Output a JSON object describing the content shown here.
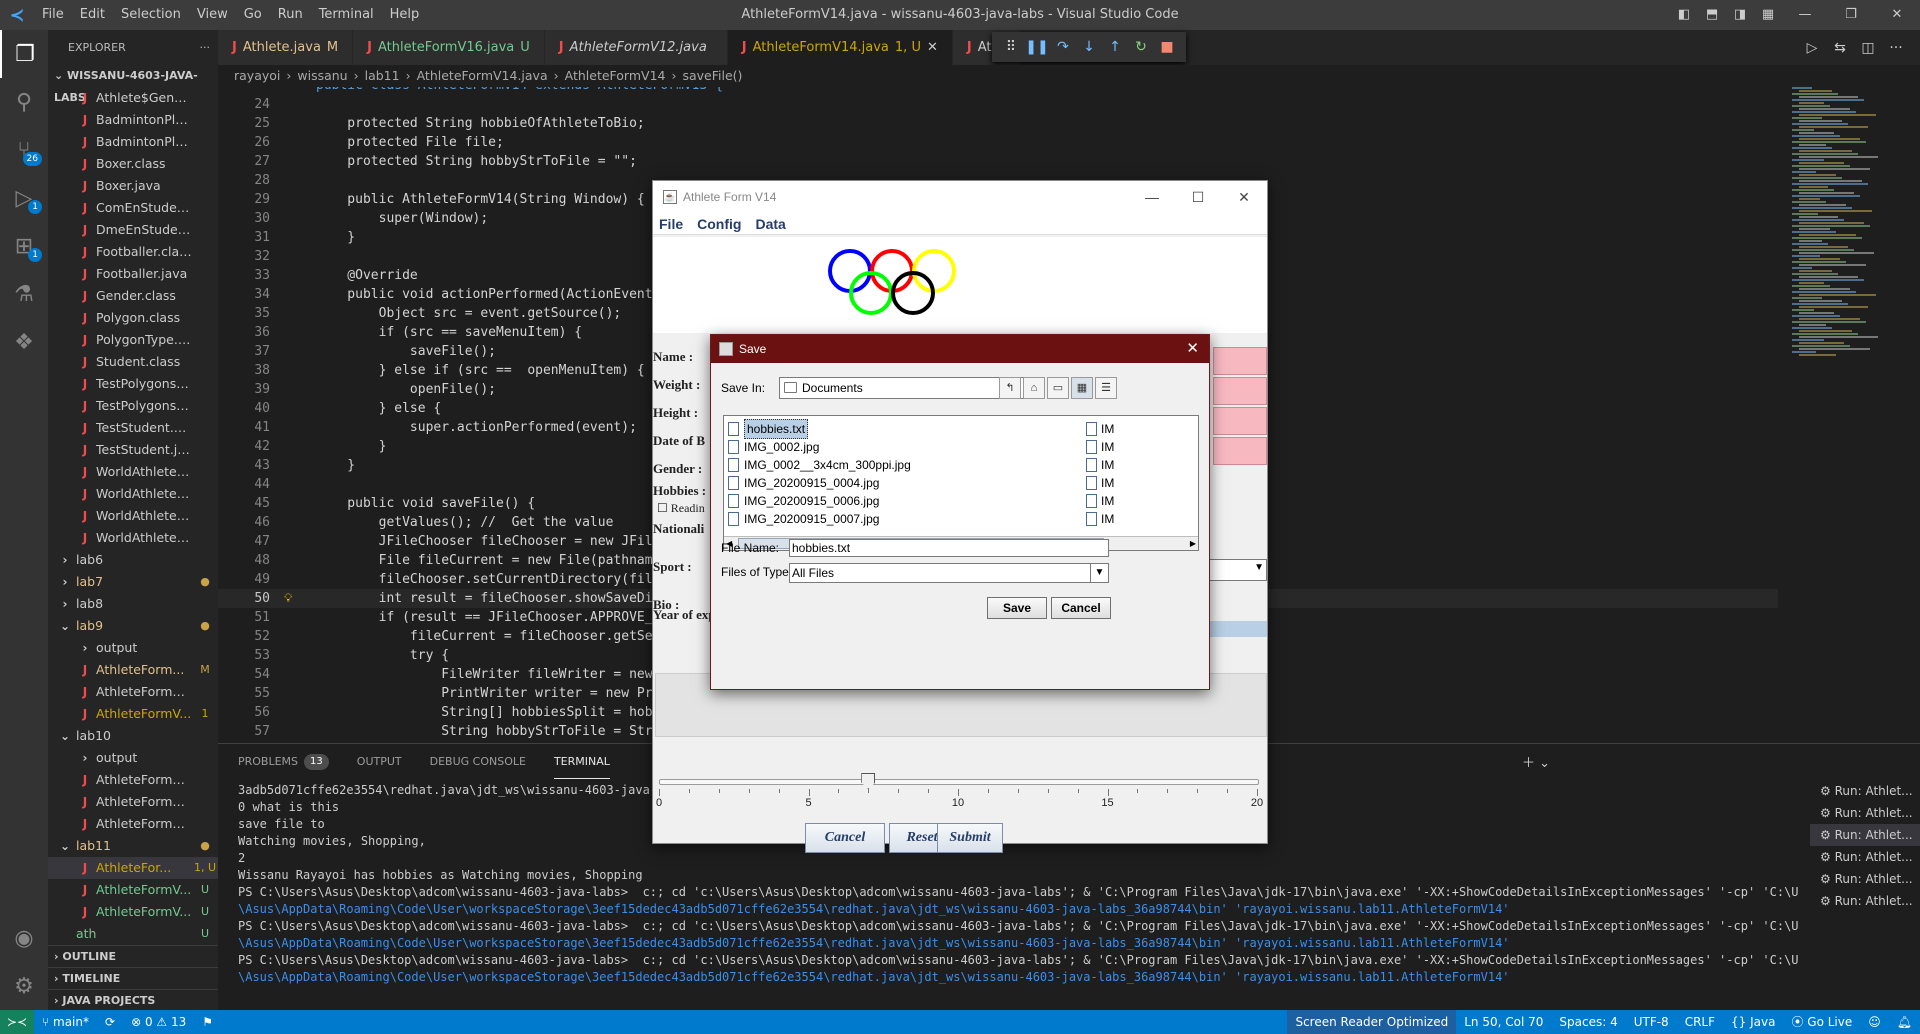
{
  "titlebar": {
    "menu": [
      "File",
      "Edit",
      "Selection",
      "View",
      "Go",
      "Run",
      "Terminal",
      "Help"
    ],
    "title": "AthleteFormV14.java - wissanu-4603-java-labs - Visual Studio Code"
  },
  "activity": {
    "scm_badge": "26",
    "debug_badge": "1",
    "ext_badge": "1"
  },
  "explorer": {
    "header": "EXPLORER",
    "project": "WISSANU-4603-JAVA-LABS",
    "items": [
      {
        "label": "Athlete$Gender.class",
        "status": "",
        "kind": "file"
      },
      {
        "label": "BadmintonPlayer.cl...",
        "status": "",
        "kind": "file"
      },
      {
        "label": "BadmintonPlayer.ja...",
        "status": "",
        "kind": "file"
      },
      {
        "label": "Boxer.class",
        "status": "",
        "kind": "file"
      },
      {
        "label": "Boxer.java",
        "status": "",
        "kind": "file"
      },
      {
        "label": "ComEnStudent.class",
        "status": "",
        "kind": "file"
      },
      {
        "label": "DmeEnStudent.class",
        "status": "",
        "kind": "file"
      },
      {
        "label": "Footballer.class",
        "status": "",
        "kind": "file"
      },
      {
        "label": "Footballer.java",
        "status": "",
        "kind": "file"
      },
      {
        "label": "Gender.class",
        "status": "",
        "kind": "file"
      },
      {
        "label": "Polygon.class",
        "status": "",
        "kind": "file"
      },
      {
        "label": "PolygonType.class",
        "status": "",
        "kind": "file"
      },
      {
        "label": "Student.class",
        "status": "",
        "kind": "file"
      },
      {
        "label": "TestPolygons.class",
        "status": "",
        "kind": "file"
      },
      {
        "label": "TestPolygons.java",
        "status": "",
        "kind": "file"
      },
      {
        "label": "TestStudent.class",
        "status": "",
        "kind": "file"
      },
      {
        "label": "TestStudent.java",
        "status": "",
        "kind": "file"
      },
      {
        "label": "WorldAthlete.class",
        "status": "",
        "kind": "file"
      },
      {
        "label": "WorldAthlete.java",
        "status": "",
        "kind": "file"
      },
      {
        "label": "WorldAthleteV2.cla...",
        "status": "",
        "kind": "file"
      },
      {
        "label": "WorldAthleteV2.java",
        "status": "",
        "kind": "file"
      },
      {
        "label": "lab6",
        "status": "",
        "kind": "folder"
      },
      {
        "label": "lab7",
        "status": "●",
        "kind": "folder-mod"
      },
      {
        "label": "lab8",
        "status": "",
        "kind": "folder"
      },
      {
        "label": "lab9",
        "status": "●",
        "kind": "folder-open-mod"
      },
      {
        "label": "output",
        "status": "",
        "kind": "subfolder"
      },
      {
        "label": "AthleteForm...",
        "status": "M",
        "kind": "subfile-mod"
      },
      {
        "label": "AthleteFormV9.java",
        "status": "",
        "kind": "subfile"
      },
      {
        "label": "AthleteFormV...",
        "status": "1",
        "kind": "subfile-warn"
      },
      {
        "label": "lab10",
        "status": "",
        "kind": "folder-open"
      },
      {
        "label": "output",
        "status": "",
        "kind": "subfolder"
      },
      {
        "label": "AthleteFormV11.java",
        "status": "",
        "kind": "subfile"
      },
      {
        "label": "AthleteFormV12.java",
        "status": "",
        "kind": "subfile"
      },
      {
        "label": "AthleteFormV13.java",
        "status": "",
        "kind": "subfile"
      },
      {
        "label": "lab11",
        "status": "●",
        "kind": "folder-open-mod"
      },
      {
        "label": "AthleteFor...",
        "status": "1, U",
        "kind": "subfile-sel"
      },
      {
        "label": "AthleteFormV...",
        "status": "U",
        "kind": "subfile-new"
      },
      {
        "label": "AthleteFormV...",
        "status": "U",
        "kind": "subfile-new"
      },
      {
        "label": "ath",
        "status": "U",
        "kind": "root-new"
      }
    ],
    "sections": [
      "OUTLINE",
      "TIMELINE",
      "JAVA PROJECTS"
    ]
  },
  "tabs": [
    {
      "label": "Athlete.java",
      "status": "M",
      "italic": false,
      "active": false
    },
    {
      "label": "AthleteFormV16.java",
      "status": "U",
      "italic": false,
      "active": false
    },
    {
      "label": "AthleteFormV12.java",
      "status": "",
      "italic": true,
      "active": false
    },
    {
      "label": "AthleteFormV14.java",
      "status": "1, U",
      "italic": false,
      "active": true
    },
    {
      "label": "Ath",
      "status": "",
      "italic": false,
      "active": false
    }
  ],
  "breadcrumb": [
    "rayayoi",
    "wissanu",
    "lab11",
    "AthleteFormV14.java",
    "AthleteFormV14",
    "saveFile()"
  ],
  "code": {
    "first_line_partial": "public class AthleteFormV14 extends AthleteFormV13 {",
    "lines": [
      {
        "n": "24",
        "t": ""
      },
      {
        "n": "25",
        "t": "    protected String hobbieOfAthleteToBio;"
      },
      {
        "n": "26",
        "t": "    protected File file;"
      },
      {
        "n": "27",
        "t": "    protected String hobbyStrToFile = \"\";"
      },
      {
        "n": "28",
        "t": ""
      },
      {
        "n": "29",
        "t": "    public AthleteFormV14(String Window) {"
      },
      {
        "n": "30",
        "t": "        super(Window);"
      },
      {
        "n": "31",
        "t": "    }"
      },
      {
        "n": "32",
        "t": ""
      },
      {
        "n": "33",
        "t": "    @Override"
      },
      {
        "n": "34",
        "t": "    public void actionPerformed(ActionEvent event) {"
      },
      {
        "n": "35",
        "t": "        Object src = event.getSource();"
      },
      {
        "n": "36",
        "t": "        if (src == saveMenuItem) {"
      },
      {
        "n": "37",
        "t": "            saveFile();"
      },
      {
        "n": "38",
        "t": "        } else if (src ==  openMenuItem) {"
      },
      {
        "n": "39",
        "t": "            openFile();"
      },
      {
        "n": "40",
        "t": "        } else {"
      },
      {
        "n": "41",
        "t": "            super.actionPerformed(event);"
      },
      {
        "n": "42",
        "t": "        }"
      },
      {
        "n": "43",
        "t": "    }"
      },
      {
        "n": "44",
        "t": ""
      },
      {
        "n": "45",
        "t": "    public void saveFile() {"
      },
      {
        "n": "46",
        "t": "        getValues(); //  Get the value"
      },
      {
        "n": "47",
        "t": "        JFileChooser fileChooser = new JFileChooser();"
      },
      {
        "n": "48",
        "t": "        File fileCurrent = new File(pathname:\"\");"
      },
      {
        "n": "49",
        "t": "        fileChooser.setCurrentDirectory(fileCurrent);"
      },
      {
        "n": "50",
        "t": "        int result = fileChooser.showSaveDialog(this);"
      },
      {
        "n": "51",
        "t": "        if (result == JFileChooser.APPROVE_OPTION) {"
      },
      {
        "n": "52",
        "t": "            fileCurrent = fileChooser.getSelectedFile();"
      },
      {
        "n": "53",
        "t": "            try {"
      },
      {
        "n": "54",
        "t": "                FileWriter fileWriter = new FileWriter(fileCurrent);"
      },
      {
        "n": "55",
        "t": "                PrintWriter writer = new PrintWriter(fileWriter);"
      },
      {
        "n": "56",
        "t": "                String[] hobbiesSplit = hobbiesStr.split(\", \");"
      },
      {
        "n": "57",
        "t": "                String hobbyStrToFile = String.join(\"\\n\", hobbiesSplit);"
      }
    ]
  },
  "panel": {
    "tabs": [
      "PROBLEMS",
      "OUTPUT",
      "DEBUG CONSOLE",
      "TERMINAL"
    ],
    "problems_count": "13",
    "terminal_lines": [
      "3adb5d071cffe62e3554\\redhat.java\\jdt_ws\\wissanu-4603-java-l",
      "0 what is this",
      "save file to",
      "Watching movies, Shopping,",
      "2",
      "Wissanu Rayayoi has hobbies as Watching movies, Shopping",
      "PS C:\\Users\\Asus\\Desktop\\adcom\\wissanu-4603-java-labs>  c:; cd 'c:\\Users\\Asus\\Desktop\\adcom\\wissanu-4603-java-labs'; & 'C:\\Program Files\\Java\\jdk-17\\bin\\java.exe' '-XX:+ShowCodeDetailsInExceptionMessages' '-cp' 'C:\\Users",
      "\\Asus\\AppData\\Roaming\\Code\\User\\workspaceStorage\\3eef15dedec43adb5d071cffe62e3554\\redhat.java\\jdt_ws\\wissanu-4603-java-labs_36a98744\\bin' 'rayayoi.wissanu.lab11.AthleteFormV14'",
      "PS C:\\Users\\Asus\\Desktop\\adcom\\wissanu-4603-java-labs>  c:; cd 'c:\\Users\\Asus\\Desktop\\adcom\\wissanu-4603-java-labs'; & 'C:\\Program Files\\Java\\jdk-17\\bin\\java.exe' '-XX:+ShowCodeDetailsInExceptionMessages' '-cp' 'C:\\Users",
      "\\Asus\\AppData\\Roaming\\Code\\User\\workspaceStorage\\3eef15dedec43adb5d071cffe62e3554\\redhat.java\\jdt_ws\\wissanu-4603-java-labs_36a98744\\bin' 'rayayoi.wissanu.lab11.AthleteFormV14'",
      "PS C:\\Users\\Asus\\Desktop\\adcom\\wissanu-4603-java-labs>  c:; cd 'c:\\Users\\Asus\\Desktop\\adcom\\wissanu-4603-java-labs'; & 'C:\\Program Files\\Java\\jdk-17\\bin\\java.exe' '-XX:+ShowCodeDetailsInExceptionMessages' '-cp' 'C:\\Users",
      "\\Asus\\AppData\\Roaming\\Code\\User\\workspaceStorage\\3eef15dedec43adb5d071cffe62e3554\\redhat.java\\jdt_ws\\wissanu-4603-java-labs_36a98744\\bin' 'rayayoi.wissanu.lab11.AthleteFormV14'"
    ],
    "run_items": [
      "Run: Athlet...",
      "Run: Athlet...",
      "Run: Athlet...",
      "Run: Athlet...",
      "Run: Athlet...",
      "Run: Athlet..."
    ]
  },
  "statusbar": {
    "branch": "main*",
    "errors": "0",
    "warnings": "13",
    "screen_reader": "Screen Reader Optimized",
    "position": "Ln 50, Col 70",
    "spaces": "Spaces: 4",
    "encoding": "UTF-8",
    "eol": "CRLF",
    "language": "Java",
    "golive": "Go Live"
  },
  "athlete_form": {
    "title": "Athlete Form V14",
    "menu": [
      "File",
      "Config",
      "Data"
    ],
    "labels": {
      "name": "Name :",
      "weight": "Weight :",
      "height": "Height :",
      "dob": "Date of B",
      "gender": "Gender :",
      "hobbies": "Hobbies :",
      "reading": "Readin",
      "nationality": "Nationali",
      "sport": "Sport :",
      "bio": "Bio :",
      "years": "Year of experience of this sport :"
    },
    "slider": {
      "min": 0,
      "max": 20,
      "value": 7,
      "tick_labels": [
        "0",
        "5",
        "10",
        "15",
        "20"
      ]
    },
    "buttons": [
      "Cancel",
      "Reset",
      "Submit"
    ]
  },
  "save_dialog": {
    "title": "Save",
    "save_in_label": "Save In:",
    "save_in_value": "Documents",
    "files_col1": [
      "hobbies.txt",
      "IMG_0002.jpg",
      "IMG_0002__3x4cm_300ppi.jpg",
      "IMG_20200915_0004.jpg",
      "IMG_20200915_0006.jpg",
      "IMG_20200915_0007.jpg"
    ],
    "files_col2": [
      "IM",
      "IM",
      "IM",
      "IM",
      "IM",
      "IM"
    ],
    "file_name_label": "File Name:",
    "file_name_value": "hobbies.txt",
    "file_type_label": "Files of Type:",
    "file_type_value": "All Files",
    "save_button": "Save",
    "cancel_button": "Cancel"
  }
}
